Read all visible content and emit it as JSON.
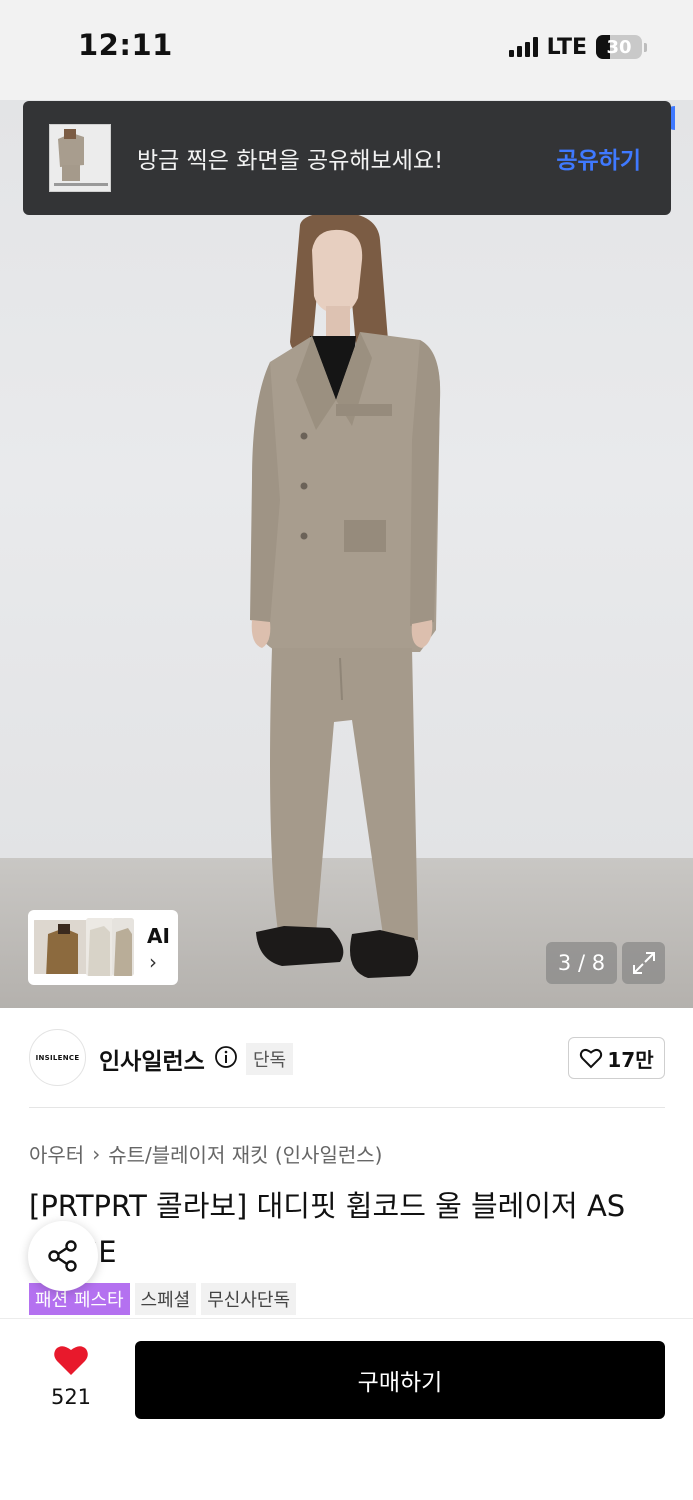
{
  "status_bar": {
    "time": "12:11",
    "network": "LTE",
    "battery": "30",
    "battery_level": 0.3
  },
  "toast": {
    "message": "방금 찍은 화면을 공유해보세요!",
    "action": "공유하기"
  },
  "gallery": {
    "ai_label": "AI",
    "counter": "3 / 8"
  },
  "brand": {
    "name": "인사일런스",
    "logo_text": "INSILENCE",
    "tag": "단독",
    "likes": "17만"
  },
  "breadcrumb": {
    "category": "아우터",
    "subcategory": "슈트/블레이저 재킷 (인사일런스)"
  },
  "product": {
    "title": "[PRTPRT 콜라보] 대디핏 휩코드 울 블레이저 AS BEIGE",
    "tags": [
      "패션 페스타",
      "스페셜",
      "무신사단독"
    ]
  },
  "bottom_bar": {
    "fav_count": "521",
    "buy_label": "구매하기"
  },
  "colors": {
    "accent_blue": "#3f79ff",
    "promo_purple": "#b471f0",
    "heart_red": "#e8192c",
    "toast_bg": "#333436"
  }
}
